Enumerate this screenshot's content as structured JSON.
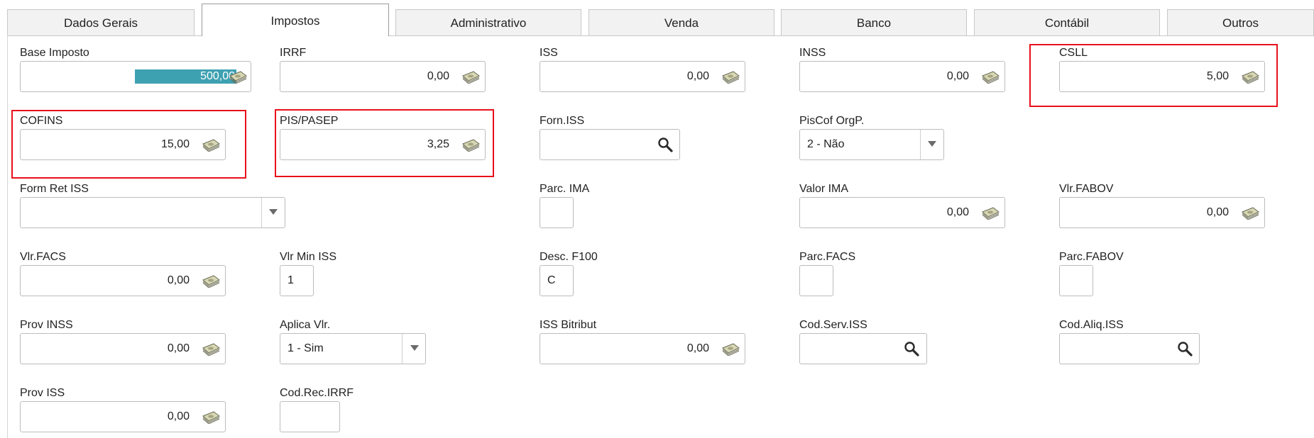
{
  "tabs": [
    {
      "label": "Dados Gerais",
      "active": false
    },
    {
      "label": "Impostos",
      "active": true
    },
    {
      "label": "Administrativo",
      "active": false
    },
    {
      "label": "Venda",
      "active": false
    },
    {
      "label": "Banco",
      "active": false
    },
    {
      "label": "Contábil",
      "active": false
    },
    {
      "label": "Outros",
      "active": false
    }
  ],
  "fields": {
    "base_imposto": {
      "label": "Base Imposto",
      "value": "500,00"
    },
    "irrf": {
      "label": "IRRF",
      "value": "0,00"
    },
    "iss": {
      "label": "ISS",
      "value": "0,00"
    },
    "inss": {
      "label": "INSS",
      "value": "0,00"
    },
    "csll": {
      "label": "CSLL",
      "value": "5,00"
    },
    "cofins": {
      "label": "COFINS",
      "value": "15,00"
    },
    "pis_pasep": {
      "label": "PIS/PASEP",
      "value": "3,25"
    },
    "forn_iss": {
      "label": "Forn.ISS",
      "value": ""
    },
    "piscof_orgp": {
      "label": "PisCof OrgP.",
      "value": "2 - Não"
    },
    "form_ret_iss": {
      "label": "Form Ret ISS",
      "value": ""
    },
    "parc_ima": {
      "label": "Parc. IMA",
      "value": ""
    },
    "valor_ima": {
      "label": "Valor IMA",
      "value": "0,00"
    },
    "vlr_fabov": {
      "label": "Vlr.FABOV",
      "value": "0,00"
    },
    "vlr_facs": {
      "label": "Vlr.FACS",
      "value": "0,00"
    },
    "vlr_min_iss": {
      "label": "Vlr Min ISS",
      "value": "1"
    },
    "desc_f100": {
      "label": "Desc. F100",
      "value": "C"
    },
    "parc_facs": {
      "label": "Parc.FACS",
      "value": ""
    },
    "parc_fabov": {
      "label": "Parc.FABOV",
      "value": ""
    },
    "prov_inss": {
      "label": "Prov INSS",
      "value": "0,00"
    },
    "aplica_vlr": {
      "label": "Aplica Vlr.",
      "value": "1 - Sim"
    },
    "iss_bitribut": {
      "label": "ISS Bitribut",
      "value": "0,00"
    },
    "cod_serv_iss": {
      "label": "Cod.Serv.ISS",
      "value": ""
    },
    "cod_aliq_iss": {
      "label": "Cod.Aliq.ISS",
      "value": ""
    },
    "prov_iss": {
      "label": "Prov ISS",
      "value": "0,00"
    },
    "cod_rec_irrf": {
      "label": "Cod.Rec.IRRF",
      "value": ""
    }
  },
  "icons": {
    "money": "money-icon",
    "search": "search-icon",
    "dropdown": "dropdown-arrow-icon"
  },
  "colors": {
    "highlight": "#e8101b",
    "selection": "#3ea1b2"
  }
}
